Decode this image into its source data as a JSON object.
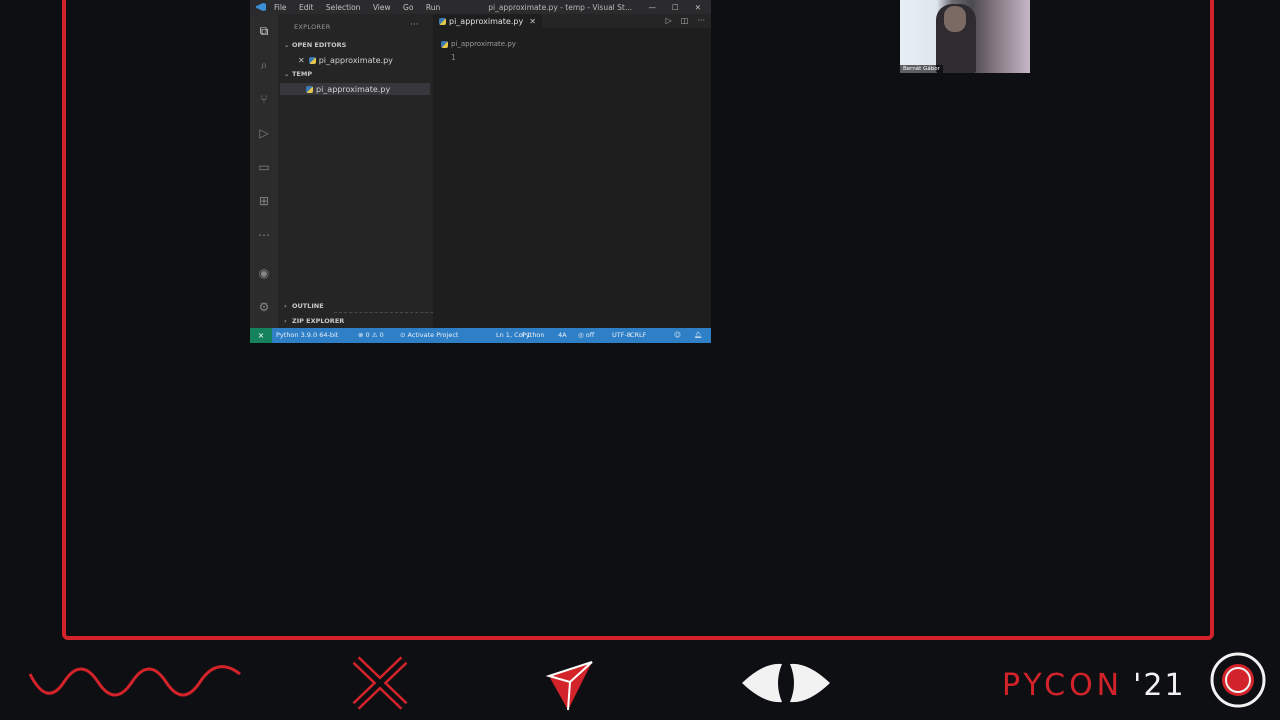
{
  "vscode": {
    "menu": [
      "File",
      "Edit",
      "Selection",
      "View",
      "Go",
      "Run"
    ],
    "window_title": "pi_approximate.py - temp - Visual St...",
    "window_controls": [
      "—",
      "☐",
      "✕"
    ],
    "sidebar": {
      "title": "EXPLORER",
      "more": "···",
      "sections": {
        "open_editors": "OPEN EDITORS",
        "temp": "TEMP",
        "outline": "OUTLINE",
        "zip_explorer": "ZIP EXPLORER"
      },
      "open_editor_file": "pi_approximate.py",
      "temp_file": "pi_approximate.py"
    },
    "editor": {
      "tab_label": "pi_approximate.py",
      "breadcrumb": "pi_approximate.py",
      "line_number": "1"
    },
    "statusbar": {
      "interpreter": "Python 3.9.0 64-bit",
      "problems": "⊗ 0 ⚠ 0",
      "task": "⊙ Activate Project",
      "position": "Ln 1, Col 1",
      "language": "Python",
      "spaces": "4A",
      "live": "◎ off",
      "encoding": "UTF-8",
      "eol": "CRLF"
    }
  },
  "webcam": {
    "name": "Bernát Gábor"
  },
  "footer": {
    "brand": "PYCON",
    "year": "'21"
  },
  "colors": {
    "accent": "#d2232a",
    "status_bar": "#2f7fc6",
    "remote": "#16825d"
  }
}
